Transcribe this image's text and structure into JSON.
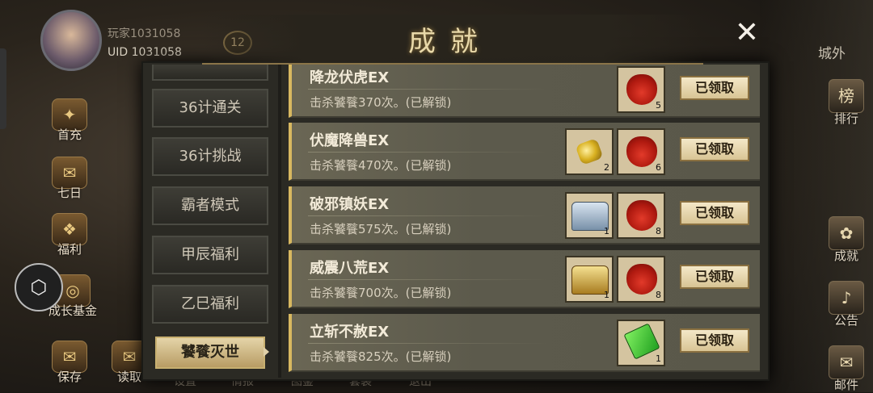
{
  "player": {
    "name": "玩家1031058",
    "uid": "UID  1031058",
    "level": "12"
  },
  "left_menu": [
    {
      "label": "首充",
      "icon": "treasure-icon"
    },
    {
      "label": "七日",
      "icon": "scroll-icon"
    },
    {
      "label": "福利",
      "icon": "gift-icon"
    },
    {
      "label": "成长基金",
      "icon": "coin-icon"
    },
    {
      "label": "保存",
      "icon": "scroll-icon"
    },
    {
      "label": "读取",
      "icon": "scroll-icon"
    }
  ],
  "bottom_menu": [
    "设置",
    "情报",
    "图鉴",
    "套装",
    "退出"
  ],
  "right_menu": {
    "top_label": "城外",
    "items": [
      {
        "label": "排行",
        "icon": "rank-icon"
      },
      {
        "label": "成就",
        "icon": "achievement-icon"
      },
      {
        "label": "公告",
        "icon": "horn-icon"
      },
      {
        "label": "邮件",
        "icon": "mail-icon"
      }
    ]
  },
  "panel": {
    "title": "成就",
    "close": "✕"
  },
  "tabs": [
    {
      "label": "36计通关",
      "active": false
    },
    {
      "label": "36计挑战",
      "active": false
    },
    {
      "label": "霸者模式",
      "active": false
    },
    {
      "label": "甲辰福利",
      "active": false
    },
    {
      "label": "乙巳福利",
      "active": false
    },
    {
      "label": "饕餮灭世",
      "active": true
    }
  ],
  "achievements": [
    {
      "title": "降龙伏虎EX",
      "desc": "击杀饕餮370次。(已解锁)",
      "button": "已领取",
      "rewards": [
        {
          "type": "red-bag",
          "count": "5"
        }
      ]
    },
    {
      "title": "伏魔降兽EX",
      "desc": "击杀饕餮470次。(已解锁)",
      "button": "已领取",
      "rewards": [
        {
          "type": "gold-ingot",
          "count": "2"
        },
        {
          "type": "red-bag",
          "count": "6"
        }
      ]
    },
    {
      "title": "破邪镇妖EX",
      "desc": "击杀饕餮575次。(已解锁)",
      "button": "已领取",
      "rewards": [
        {
          "type": "silver-chest",
          "count": "1"
        },
        {
          "type": "red-bag",
          "count": "8"
        }
      ]
    },
    {
      "title": "威震八荒EX",
      "desc": "击杀饕餮700次。(已解锁)",
      "button": "已领取",
      "rewards": [
        {
          "type": "gold-chest",
          "count": "1"
        },
        {
          "type": "red-bag",
          "count": "8"
        }
      ]
    },
    {
      "title": "立斩不赦EX",
      "desc": "击杀饕餮825次。(已解锁)",
      "button": "已领取",
      "rewards": [
        {
          "type": "green-book",
          "count": "1"
        }
      ]
    }
  ],
  "colors": {
    "accent_gold": "#d8b860",
    "panel_bg": "#2b2a24",
    "button_bg": "#f4e8c8"
  }
}
